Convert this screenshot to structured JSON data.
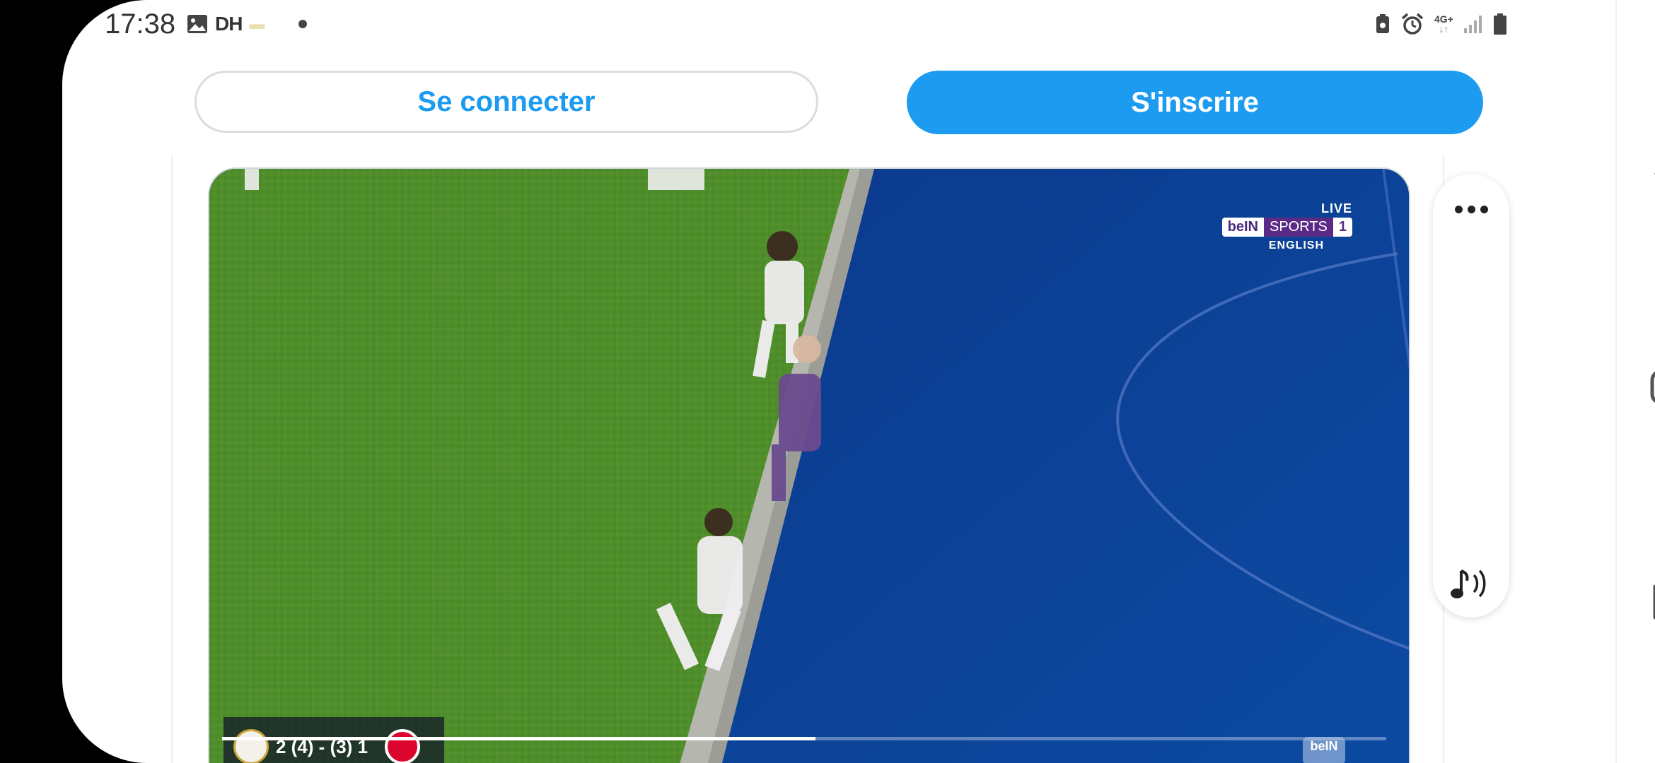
{
  "status_bar": {
    "time": "17:38",
    "left_icons": [
      "image-icon",
      "dh-app-icon",
      "notification-icon",
      "dot-indicator"
    ],
    "dh_label": "DH",
    "network_label": "4G+",
    "right_icons": [
      "battery-saver-icon",
      "alarm-icon",
      "signal-icon",
      "battery-icon"
    ]
  },
  "auth": {
    "login_label": "Se connecter",
    "signup_label": "S'inscrire"
  },
  "video": {
    "broadcaster": {
      "live_label": "LIVE",
      "brand": "beIN",
      "brand_sub": "SPORTS",
      "channel": "1",
      "language": "ENGLISH"
    },
    "scorebug": {
      "score": "2 (4) - (3) 1"
    },
    "corner_brand": "beIN",
    "progress": 0.51
  },
  "side_panel": {
    "more_icon": "more-dots-icon",
    "sound_icon": "sound-icon"
  },
  "nav": {
    "back_icon": "back-chevron-icon",
    "home_icon": "home-icon",
    "recent_icon": "recent-apps-icon"
  },
  "colors": {
    "accent": "#1d9bf0",
    "pitch_green": "#4f8f2a",
    "overlay_blue": "#0b3f93"
  }
}
